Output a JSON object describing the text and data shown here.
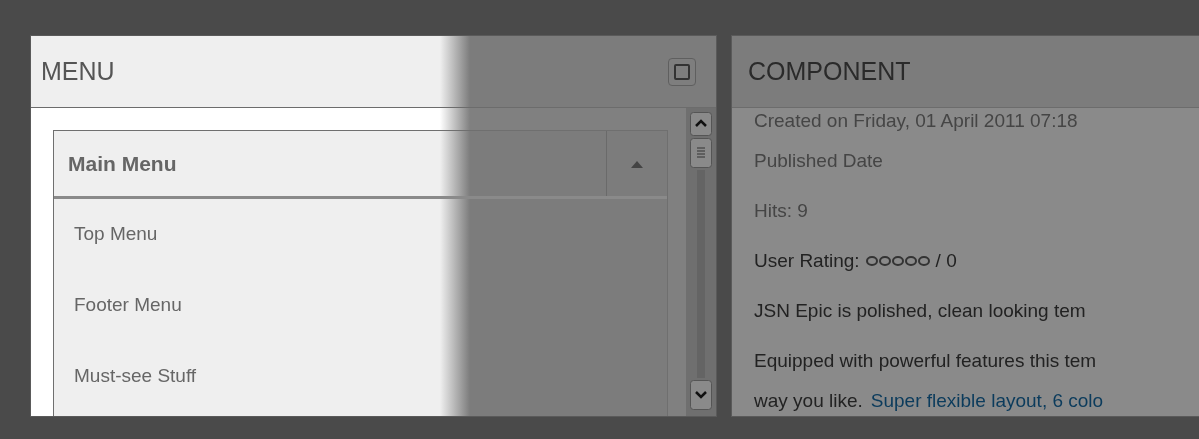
{
  "menu_panel": {
    "title": "MENU",
    "module": {
      "title": "Main Menu",
      "expanded": true,
      "items": [
        {
          "label": "Top Menu"
        },
        {
          "label": "Footer Menu"
        },
        {
          "label": "Must-see Stuff"
        }
      ]
    }
  },
  "component_panel": {
    "title": "COMPONENT",
    "created": "Created on Friday, 01 April 2011 07:18",
    "published": "Published Date",
    "hits": "Hits: 9",
    "rating": {
      "label": "User Rating:",
      "stars": 0,
      "count": "/ 0"
    },
    "paragraphs": [
      "JSN Epic is polished, clean looking tem",
      "Equipped with powerful features this tem"
    ],
    "last_line": {
      "text": "way you like.",
      "link": "Super flexible layout, 6 colo"
    }
  }
}
